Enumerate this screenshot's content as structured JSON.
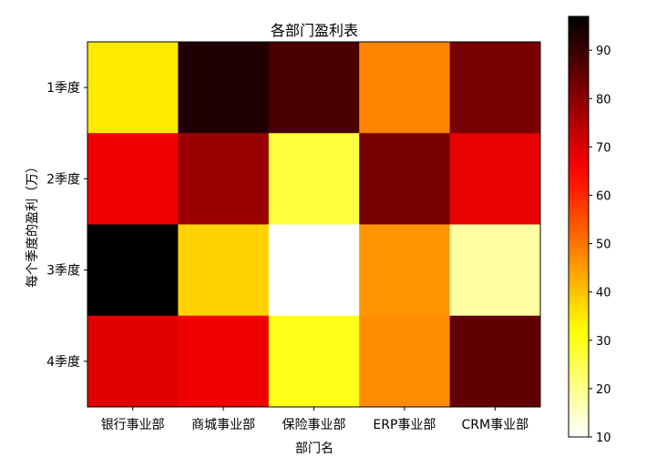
{
  "chart_data": {
    "type": "heatmap",
    "title": "各部门盈利表",
    "xlabel": "部门名",
    "ylabel": "每个季度的盈利（万）",
    "x_categories": [
      "银行事业部",
      "商城事业部",
      "保险事业部",
      "ERP事业部",
      "CRM事业部"
    ],
    "y_categories": [
      "1季度",
      "2季度",
      "3季度",
      "4季度"
    ],
    "values": [
      [
        35,
        93,
        88,
        48,
        82
      ],
      [
        67,
        78,
        27,
        82,
        68
      ],
      [
        97,
        38,
        10,
        46,
        18
      ],
      [
        69,
        67,
        30,
        47,
        85
      ]
    ],
    "colormap": "hot_r",
    "colorbar": {
      "min": 10,
      "max": 97,
      "ticks": [
        10,
        20,
        30,
        40,
        50,
        60,
        70,
        80,
        90
      ]
    }
  }
}
